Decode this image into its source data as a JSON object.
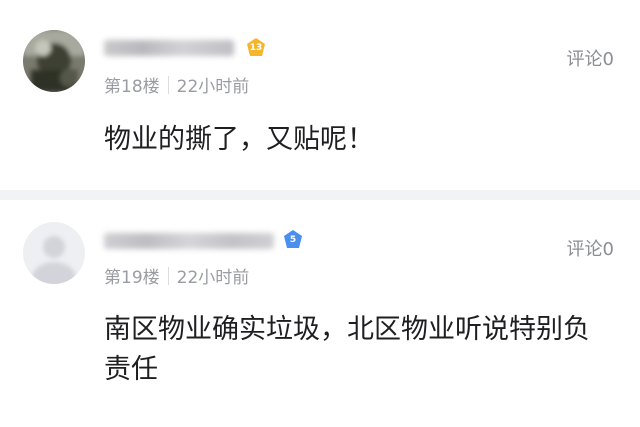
{
  "posts": [
    {
      "level": "13",
      "floor": "第18楼",
      "time": "22小时前",
      "comment_label": "评论0",
      "content": "物业的撕了，又贴呢！",
      "badge_color": "#f5b62d"
    },
    {
      "level": "5",
      "floor": "第19楼",
      "time": "22小时前",
      "comment_label": "评论0",
      "content": "南区物业确实垃圾，北区物业听说特别负责任",
      "badge_color": "#4a8ff0"
    }
  ],
  "colors": {
    "divider": "#f2f3f5",
    "meta_text": "#9a9ca3",
    "content_text": "#1f1f22"
  },
  "icons": {
    "avatar_1": "blurred-avatar",
    "avatar_2": "blurred-avatar",
    "badge": "diamond-level-badge"
  }
}
